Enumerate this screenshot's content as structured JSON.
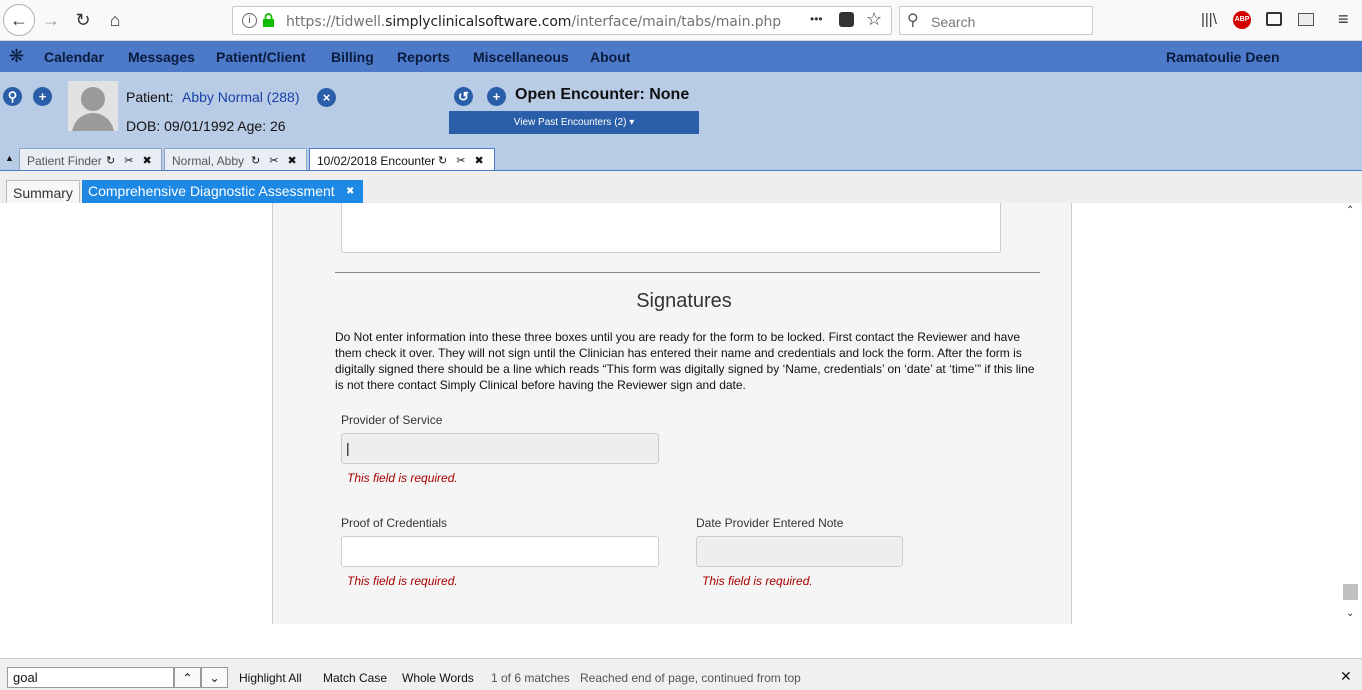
{
  "browser": {
    "url_prefix": "https://tidwell.",
    "url_host": "simplyclinicalsoftware.com",
    "url_path": "/interface/main/tabs/main.php",
    "search_placeholder": "Search",
    "more_label": "•••"
  },
  "menubar": {
    "items": [
      "Calendar",
      "Messages",
      "Patient/Client",
      "Billing",
      "Reports",
      "Miscellaneous",
      "About"
    ],
    "user": "Ramatoulie Deen"
  },
  "patient": {
    "label": "Patient:",
    "name": "Abby Normal (288)",
    "dob_line": "DOB: 09/01/1992 Age: 26",
    "encounter_label": "Open Encounter: None",
    "past_encounters_label": "View Past Encounters  (2) ▾"
  },
  "doc_tabs": [
    {
      "label": "Patient Finder",
      "tools": "↻ ✂ ✖"
    },
    {
      "label": "Normal, Abby",
      "tools": "↻ ✂ ✖"
    },
    {
      "label": "10/02/2018 Encounter",
      "tools": "↻ ✂ ✖"
    }
  ],
  "sub_tabs": {
    "summary": "Summary",
    "cda": "Comprehensive Diagnostic Assessment",
    "cda_close": "✖"
  },
  "form": {
    "heading": "Signatures",
    "instructions": "Do Not enter information into these three boxes until you are ready for the form to be locked. First contact the Reviewer and have them check it over. They will not sign until the Clinician has entered their name and credentials and lock the form. After the form is digitally signed there should be a line which reads “This form was digitally signed by ‘Name, credentials’ on ‘date’ at ‘time’” if this line is not there contact Simply Clinical before having the Reviewer sign and date.",
    "provider_label": "Provider of Service",
    "provider_value": "|",
    "credentials_label": "Proof of Credentials",
    "date_label": "Date Provider Entered Note",
    "required_msg": "This field is required."
  },
  "findbar": {
    "query": "goal",
    "highlight_all": "Highlight All",
    "match_case": "Match Case",
    "whole_words": "Whole Words",
    "match_count": "1 of 6 matches",
    "status": "Reached end of page, continued from top",
    "close": "✕"
  }
}
